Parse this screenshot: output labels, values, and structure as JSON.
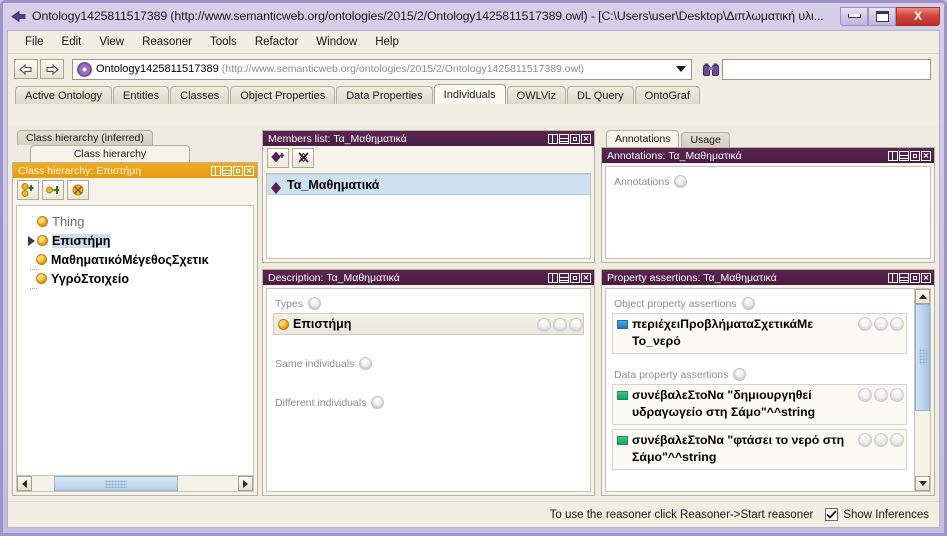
{
  "window": {
    "title": "Ontology1425811517389 (http://www.semanticweb.org/ontologies/2015/2/Ontology1425811517389.owl) - [C:\\Users\\user\\Desktop\\Διπλωματική υλι...",
    "app_icon": "protege-icon",
    "minimize_label": "",
    "maximize_label": "",
    "close_label": "X"
  },
  "menubar": {
    "items": [
      {
        "label": "File"
      },
      {
        "label": "Edit"
      },
      {
        "label": "View"
      },
      {
        "label": "Reasoner"
      },
      {
        "label": "Tools"
      },
      {
        "label": "Refactor"
      },
      {
        "label": "Window"
      },
      {
        "label": "Help"
      }
    ]
  },
  "toolbar": {
    "back_icon": "back-arrow-icon",
    "forward_icon": "forward-arrow-icon",
    "ontology_icon": "ontology-icon",
    "ontology_name": "Ontology1425811517389",
    "ontology_uri": "(http://www.semanticweb.org/ontologies/2015/2/Ontology1425811517389.owl)",
    "dropdown_icon": "chevron-down-icon",
    "search_icon": "binoculars-search-icon",
    "search_value": "",
    "search_placeholder": ""
  },
  "tabs": [
    {
      "label": "Active Ontology",
      "active": false
    },
    {
      "label": "Entities",
      "active": false
    },
    {
      "label": "Classes",
      "active": false
    },
    {
      "label": "Object Properties",
      "active": false
    },
    {
      "label": "Data Properties",
      "active": false
    },
    {
      "label": "Individuals",
      "active": true
    },
    {
      "label": "OWLViz",
      "active": false
    },
    {
      "label": "DL Query",
      "active": false
    },
    {
      "label": "OntoGraf",
      "active": false
    }
  ],
  "class_hierarchy": {
    "outer_tab": "Class hierarchy (inferred)",
    "inner_tab": "Class hierarchy",
    "header": "Class hierarchy: Επιστήμη",
    "toolbar_buttons": [
      {
        "name": "add-subclass-button"
      },
      {
        "name": "add-sibling-class-button"
      },
      {
        "name": "delete-class-button"
      }
    ],
    "tree": [
      {
        "label": "Thing",
        "level": 0,
        "style": "root",
        "expanded": true,
        "twisty": false
      },
      {
        "label": "Επιστήμη",
        "level": 1,
        "style": "selected",
        "twisty": true
      },
      {
        "label": "ΜαθηματικόΜέγεθοςΣχετικ",
        "level": 1,
        "style": "normal",
        "twisty": false
      },
      {
        "label": "ΥγρόΣτοιχείο",
        "level": 1,
        "style": "normal",
        "twisty": false
      }
    ]
  },
  "members_list": {
    "header": "Members list: Τα_Μαθηματικά",
    "toolbar_buttons": [
      {
        "name": "add-individual-button"
      },
      {
        "name": "delete-individual-button"
      }
    ],
    "items": [
      {
        "label": "Τα_Μαθηματικά",
        "selected": true
      }
    ]
  },
  "description": {
    "header": "Description: Τα_Μαθηματικά",
    "sections": [
      {
        "title": "Types",
        "rows": [
          {
            "label": "Επιστήμη",
            "icon": "class-icon"
          }
        ]
      },
      {
        "title": "Same individuals",
        "rows": []
      },
      {
        "title": "Different individuals",
        "rows": []
      }
    ]
  },
  "annotations": {
    "tabs": [
      {
        "label": "Annotations",
        "active": true
      },
      {
        "label": "Usage",
        "active": false
      }
    ],
    "header": "Annotations: Τα_Μαθηματικά",
    "section_title": "Annotations",
    "rows": []
  },
  "property_assertions": {
    "header": "Property assertions: Τα_Μαθηματικά",
    "object_section_title": "Object property assertions",
    "object_rows": [
      {
        "text": "περιέχειΠροβλήματαΣχετικάΜε Το_νερό",
        "icon": "object-property-icon"
      }
    ],
    "data_section_title": "Data property assertions",
    "data_rows": [
      {
        "text": "συνέβαλεΣτοΝα  \"δημιουργηθεί υδραγωγείο στη Σάμο\"^^string",
        "icon": "data-property-icon"
      },
      {
        "text": "συνέβαλεΣτοΝα  \"φτάσει το νερό στη Σάμο\"^^string",
        "icon": "data-property-icon"
      }
    ]
  },
  "statusbar": {
    "message": "To use the reasoner click Reasoner->Start reasoner",
    "checkbox_label": "Show Inferences",
    "checkbox_checked": true
  },
  "colors": {
    "panel_header": "#4a1c42",
    "panel_header_gold": "#e39d12",
    "selection": "#cfe0f0",
    "class_icon": "#f0a81c",
    "individual_icon": "#5c1f57",
    "object_property": "#2277bb",
    "data_property": "#17a063",
    "window_chrome": "#b0a6d4",
    "close_button": "#c8362c"
  }
}
